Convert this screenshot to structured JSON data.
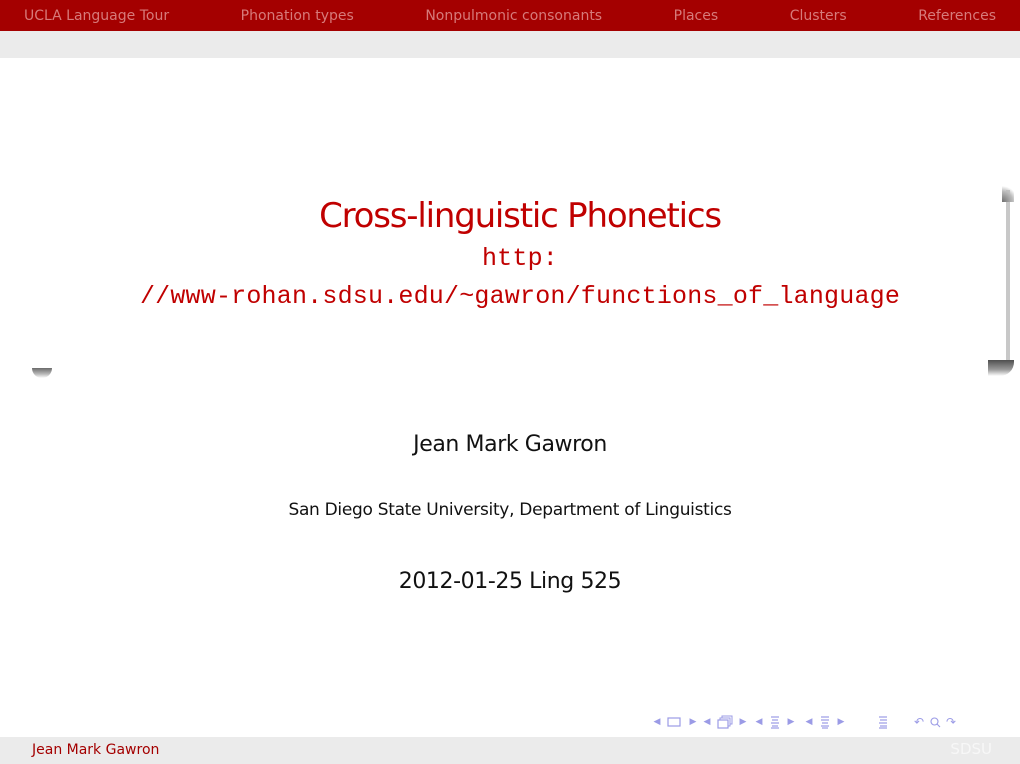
{
  "nav": {
    "sections": [
      {
        "label": "UCLA Language Tour"
      },
      {
        "label": "Phonation types"
      },
      {
        "label": "Nonpulmonic consonants"
      },
      {
        "label": "Places"
      },
      {
        "label": "Clusters"
      },
      {
        "label": "References"
      }
    ]
  },
  "title_slide": {
    "title": "Cross-linguistic Phonetics",
    "url_line1": "http:",
    "url_line2": "//www-rohan.sdsu.edu/~gawron/functions_of_language",
    "author": "Jean Mark Gawron",
    "institute": "San Diego State University, Department of Linguistics",
    "date": "2012-01-25 Ling 525"
  },
  "footer": {
    "author": "Jean Mark Gawron",
    "institute": "SDSU"
  },
  "beamer_nav": {
    "icons": [
      "prev-slide-icon",
      "slide-icon",
      "next-slide-icon",
      "prev-frame-icon",
      "frame-icon",
      "next-frame-icon",
      "prev-subsection-icon",
      "subsection-icon",
      "next-subsection-icon",
      "prev-section-icon",
      "section-icon",
      "next-section-icon",
      "document-icon",
      "back-icon",
      "search-icon",
      "forward-icon"
    ],
    "color": "#9b9be6"
  },
  "colors": {
    "accent": "#a40000",
    "title": "#c00000",
    "bar_gray": "#ebebeb"
  }
}
